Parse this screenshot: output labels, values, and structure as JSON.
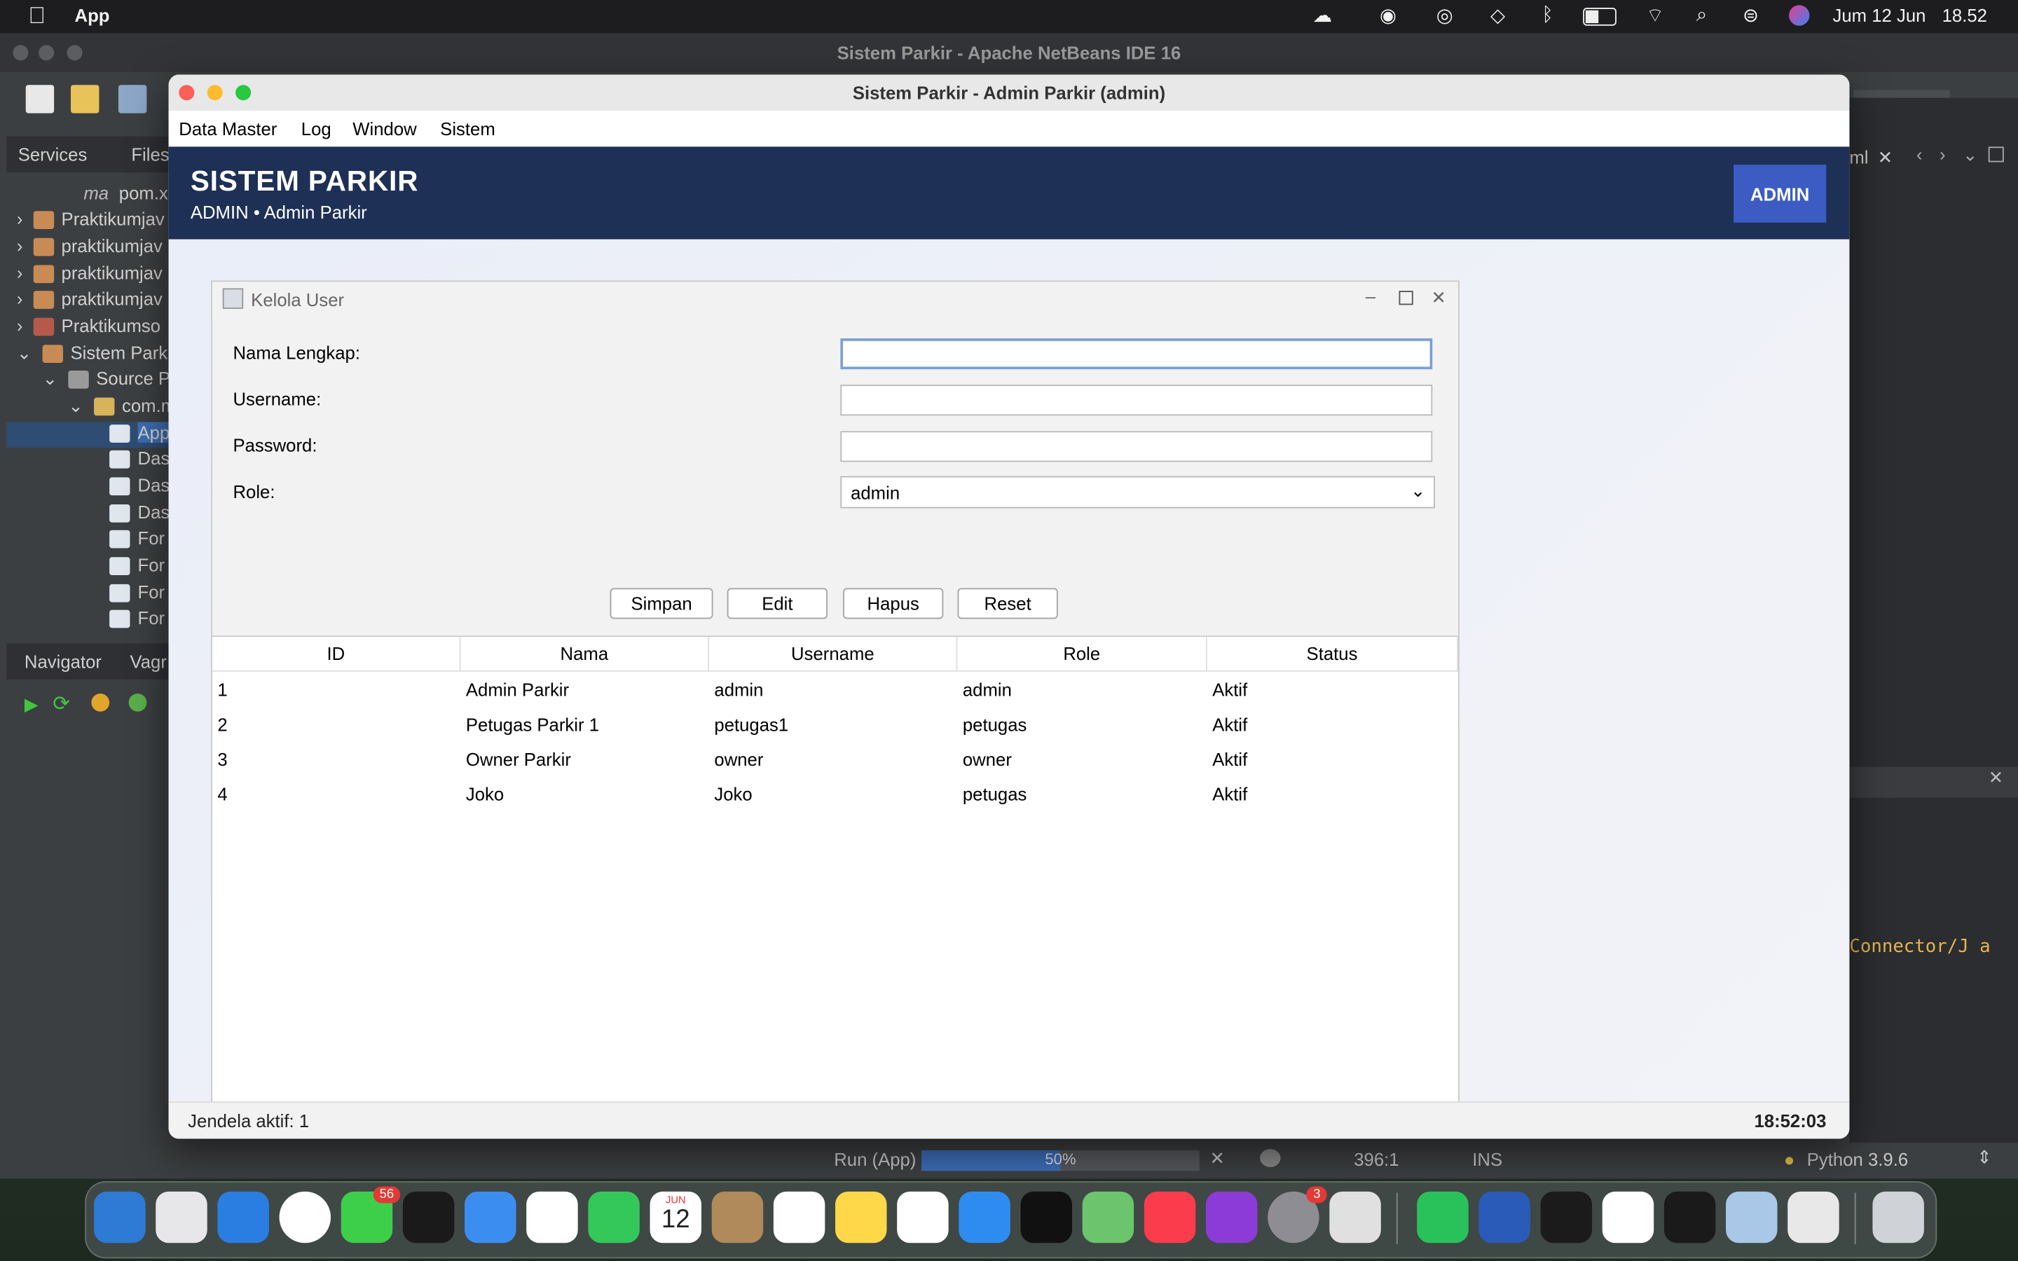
{
  "menubar": {
    "app_name": "App",
    "date": "Jum 12 Jun",
    "time": "18.52",
    "icons": [
      "apple-logo",
      "creative-cloud-icon",
      "screen-record-icon",
      "vpn-icon",
      "diamond-icon",
      "bluetooth-icon",
      "battery-icon",
      "wifi-icon",
      "search-icon",
      "control-center-icon",
      "siri-icon"
    ]
  },
  "netbeans": {
    "title": "Sistem Parkir - Apache NetBeans IDE 16",
    "left_tabs": [
      "Services",
      "Files"
    ],
    "tree": [
      {
        "label": "pom.x"
      },
      {
        "label": "Praktikumjav"
      },
      {
        "label": "praktikumjav"
      },
      {
        "label": "praktikumjav"
      },
      {
        "label": "praktikumjav"
      },
      {
        "label": "Praktikumso"
      },
      {
        "label": "Sistem Parki"
      },
      {
        "label": "Source Pa"
      },
      {
        "label": "com.m"
      },
      {
        "label": "App"
      },
      {
        "label": "Das"
      },
      {
        "label": "Das"
      },
      {
        "label": "Das"
      },
      {
        "label": "For"
      },
      {
        "label": "For"
      },
      {
        "label": "For"
      },
      {
        "label": "For"
      }
    ],
    "navigator_tabs": [
      "Navigator",
      "Vagr"
    ],
    "right_tab": "ml",
    "output_text": "Connector/J a",
    "status": {
      "run_label": "Run (App)",
      "progress": "50%",
      "progress_fraction": 0.5,
      "position": "396:1",
      "mode": "INS",
      "python": "Python 3.9.6"
    }
  },
  "app": {
    "window_title": "Sistem Parkir - Admin Parkir (admin)",
    "menu": [
      "Data Master",
      "Log",
      "Window",
      "Sistem"
    ],
    "header_title": "SISTEM PARKIR",
    "header_subtitle": "ADMIN • Admin Parkir",
    "badge": "ADMIN",
    "status_left": "Jendela aktif: 1",
    "status_right": "18:52:03"
  },
  "kelola_user": {
    "title": "Kelola User",
    "fields": {
      "nama_label": "Nama Lengkap:",
      "nama_value": "",
      "username_label": "Username:",
      "username_value": "",
      "password_label": "Password:",
      "password_value": "",
      "role_label": "Role:",
      "role_value": "admin"
    },
    "buttons": {
      "simpan": "Simpan",
      "edit": "Edit",
      "hapus": "Hapus",
      "reset": "Reset"
    },
    "table": {
      "columns": [
        "ID",
        "Nama",
        "Username",
        "Role",
        "Status"
      ],
      "rows": [
        [
          "1",
          "Admin Parkir",
          "admin",
          "admin",
          "Aktif"
        ],
        [
          "2",
          "Petugas Parkir 1",
          "petugas1",
          "petugas",
          "Aktif"
        ],
        [
          "3",
          "Owner Parkir",
          "owner",
          "owner",
          "Aktif"
        ],
        [
          "4",
          "Joko",
          "Joko",
          "petugas",
          "Aktif"
        ]
      ]
    }
  },
  "dock": {
    "apps": [
      {
        "name": "finder",
        "color": "#2e7bd6"
      },
      {
        "name": "launchpad",
        "color": "#e7e7ea"
      },
      {
        "name": "safari",
        "color": "#2a7de1"
      },
      {
        "name": "chrome",
        "color": "#ffffff"
      },
      {
        "name": "messages",
        "color": "#3ecf4a",
        "badge": "56"
      },
      {
        "name": "opera",
        "color": "#1a1a1a"
      },
      {
        "name": "mail",
        "color": "#3b8ef0"
      },
      {
        "name": "photos",
        "color": "#ffffff"
      },
      {
        "name": "facetime",
        "color": "#34c759"
      },
      {
        "name": "calendar",
        "color": "#ffffff",
        "month": "JUN",
        "day": "12"
      },
      {
        "name": "contacts",
        "color": "#b08a5a"
      },
      {
        "name": "reminders",
        "color": "#ffffff"
      },
      {
        "name": "notes",
        "color": "#ffd84a"
      },
      {
        "name": "freeform",
        "color": "#ffffff"
      },
      {
        "name": "app-store",
        "color": "#2e8cf0"
      },
      {
        "name": "apple-tv",
        "color": "#111111"
      },
      {
        "name": "maps",
        "color": "#6cc46c"
      },
      {
        "name": "music",
        "color": "#fa3c4c"
      },
      {
        "name": "podcasts",
        "color": "#8c3bd8"
      },
      {
        "name": "system-settings",
        "color": "#8d8d93",
        "badge": "3"
      },
      {
        "name": "iphone-mirroring",
        "color": "#e0e0e0"
      },
      {
        "name": "whatsapp",
        "color": "#29c25a"
      },
      {
        "name": "word",
        "color": "#2b5bb8"
      },
      {
        "name": "android-studio",
        "color": "#1b1b1b"
      },
      {
        "name": "vscode",
        "color": "#ffffff"
      },
      {
        "name": "terminal",
        "color": "#1a1a1a"
      },
      {
        "name": "netbeans",
        "color": "#a9c7e6"
      },
      {
        "name": "java",
        "color": "#e8e8e8"
      },
      {
        "name": "trash",
        "color": "#cfd2d6"
      }
    ]
  }
}
